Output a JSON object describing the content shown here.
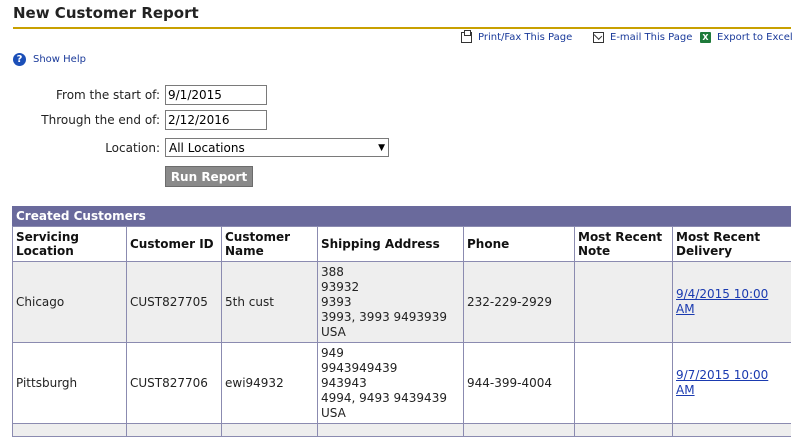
{
  "title": "New Customer Report",
  "toolbar": {
    "print": {
      "label": "Print/Fax This Page",
      "icon": "printer-icon"
    },
    "email": {
      "label": "E-mail This Page",
      "icon": "envelope-icon"
    },
    "excel": {
      "label": "Export to Excel",
      "icon": "excel-icon"
    }
  },
  "help": {
    "label": "Show Help",
    "icon": "question-icon"
  },
  "form": {
    "start_label": "From the start of:",
    "start_value": "9/1/2015",
    "end_label": "Through the end of:",
    "end_value": "2/12/2016",
    "location_label": "Location:",
    "location_value": "All Locations",
    "run_label": "Run Report"
  },
  "grid": {
    "caption": "Created Customers",
    "columns": [
      "Servicing Location",
      "Customer ID",
      "Customer Name",
      "Shipping Address",
      "Phone",
      "Most Recent Note",
      "Most Recent Delivery"
    ],
    "rows": [
      {
        "location": "Chicago",
        "customer_id": "CUST827705",
        "name": "5th cust",
        "address": [
          "388",
          "93932",
          "9393",
          "3993, 3993 9493939",
          "USA"
        ],
        "phone": "232-229-2929",
        "note": "",
        "delivery": "9/4/2015 10:00 AM"
      },
      {
        "location": "Pittsburgh",
        "customer_id": "CUST827706",
        "name": "ewi94932",
        "address": [
          "949",
          "9943949439",
          "943943",
          "4994, 9493 9439439",
          "USA"
        ],
        "phone": "944-399-4004",
        "note": "",
        "delivery": "9/7/2015 10:00 AM"
      }
    ]
  },
  "colors": {
    "title_rule": "#c8a000",
    "caption_bg": "#6a6a9c",
    "link": "#1a3ab0",
    "button_bg": "#8a8a8a"
  }
}
